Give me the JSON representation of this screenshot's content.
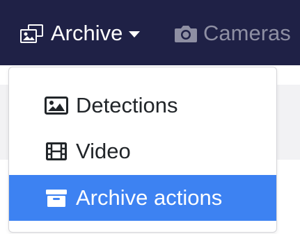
{
  "navbar": {
    "archive": {
      "label": "Archive",
      "icon": "archive-images-icon"
    },
    "cameras": {
      "label": "Cameras",
      "icon": "camera-icon"
    }
  },
  "dropdown": {
    "items": [
      {
        "label": "Detections",
        "icon": "image-icon",
        "active": false
      },
      {
        "label": "Video",
        "icon": "film-icon",
        "active": false
      },
      {
        "label": "Archive actions",
        "icon": "archive-box-icon",
        "active": true
      }
    ]
  },
  "colors": {
    "navbar_bg": "#1f2146",
    "active_item_bg": "#3d82f2",
    "muted_nav_text": "#8e8fa3"
  }
}
